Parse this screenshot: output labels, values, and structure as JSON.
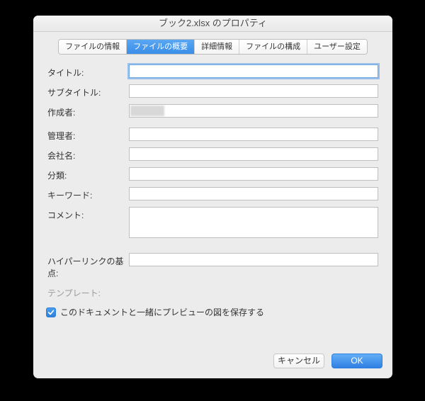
{
  "window": {
    "title": "ブック2.xlsx のプロパティ"
  },
  "tabs": [
    {
      "label": "ファイルの情報"
    },
    {
      "label": "ファイルの概要"
    },
    {
      "label": "詳細情報"
    },
    {
      "label": "ファイルの構成"
    },
    {
      "label": "ユーザー設定"
    }
  ],
  "active_tab": 1,
  "fields": {
    "title": {
      "label": "タイトル:",
      "value": ""
    },
    "subtitle": {
      "label": "サブタイトル:",
      "value": ""
    },
    "author": {
      "label": "作成者:",
      "value": ""
    },
    "manager": {
      "label": "管理者:",
      "value": ""
    },
    "company": {
      "label": "会社名:",
      "value": ""
    },
    "category": {
      "label": "分類:",
      "value": ""
    },
    "keywords": {
      "label": "キーワード:",
      "value": ""
    },
    "comments": {
      "label": "コメント:",
      "value": ""
    },
    "hyperlink": {
      "label": "ハイパーリンクの基点:",
      "value": ""
    },
    "template": {
      "label": "テンプレート:"
    }
  },
  "checkbox": {
    "label": "このドキュメントと一緒にプレビューの図を保存する",
    "checked": true
  },
  "buttons": {
    "cancel": "キャンセル",
    "ok": "OK"
  }
}
